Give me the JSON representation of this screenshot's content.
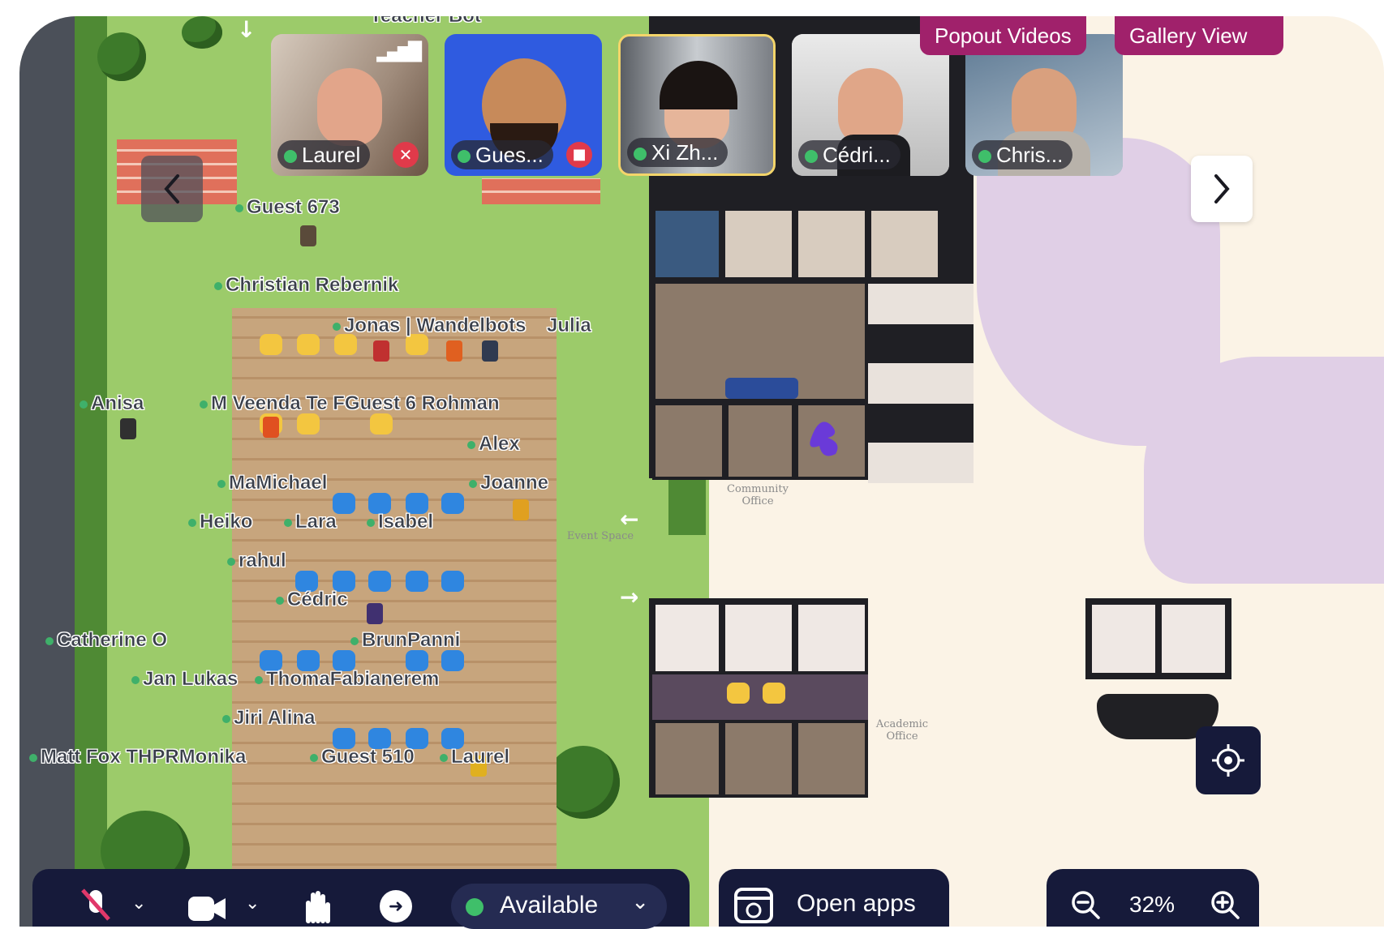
{
  "toolbar_top": {
    "popout_label": "Popout Videos",
    "gallery_label": "Gallery View"
  },
  "video_tiles": [
    {
      "name": "Laurel",
      "status": "muted"
    },
    {
      "name": "Gues...",
      "status": "camera-off"
    },
    {
      "name": "Xi Zh...",
      "status": "speaking"
    },
    {
      "name": "Cédri...",
      "status": "active"
    },
    {
      "name": "Chris...",
      "status": "active"
    }
  ],
  "map": {
    "partial_top_label": "Teacher Bot",
    "players": [
      "Guest 673",
      "Christian Rebernik",
      "Jonas | Wandelbots",
      "Julia",
      "Anisa",
      "M Veenda Te FGuest 6 Rohman",
      "Alex",
      "MaMichael",
      "Joanne",
      "Heiko",
      "Lara",
      "Isabel",
      "rahul",
      "Cédric",
      "Catherine O",
      "BrunPanni",
      "Jan Lukas",
      "ThomaFabianerem",
      "Jiri Alina",
      "Matt Fox THPRMonika",
      "Guest 510",
      "Laurel"
    ],
    "areas": {
      "event_space": "Event Space",
      "community_office_1": "Community",
      "community_office_2": "Office",
      "academic_office_1": "Academic",
      "academic_office_2": "Office"
    }
  },
  "bottom_bar": {
    "status_label": "Available",
    "open_apps_label": "Open apps",
    "zoom_level": "32%"
  },
  "colors": {
    "brand_magenta": "#a0216b",
    "navy": "#161a3a",
    "lawn": "#9ccb6a",
    "online_green": "#3fb06a",
    "speaking_border": "#f4d56a"
  }
}
